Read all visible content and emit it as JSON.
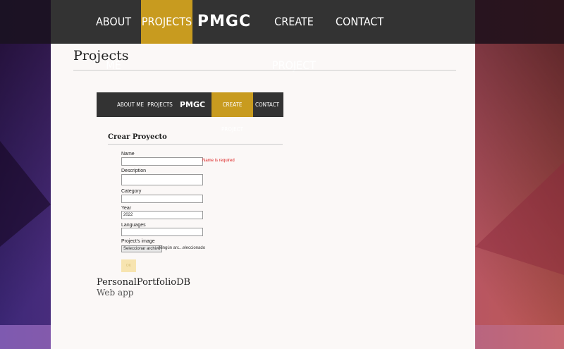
{
  "nav": {
    "items": [
      {
        "label": "ABOUT ME"
      },
      {
        "label": "PROJECTS",
        "active": true
      },
      {
        "label": "PMGC"
      },
      {
        "label": "CREATE PROJECT"
      },
      {
        "label": "CONTACT"
      }
    ]
  },
  "main": {
    "title": "Projects"
  },
  "preview": {
    "nav": {
      "items": [
        {
          "label": "ABOUT ME"
        },
        {
          "label": "PROJECTS"
        },
        {
          "label": "PMGC"
        },
        {
          "label": "CREATE PROJECT",
          "active": true
        },
        {
          "label": "CONTACT"
        }
      ]
    },
    "form": {
      "title": "Crear Proyecto",
      "fields": {
        "name": {
          "label": "Name",
          "value": "",
          "error": "Name is required"
        },
        "description": {
          "label": "Description",
          "value": ""
        },
        "category": {
          "label": "Category",
          "value": ""
        },
        "year": {
          "label": "Year",
          "value": "2022"
        },
        "languages": {
          "label": "Languages",
          "value": ""
        },
        "image": {
          "label": "Project's image",
          "button": "Seleccionar archivo",
          "status": "Ningún arc...eleccionado"
        }
      },
      "submit_label": "OK"
    }
  },
  "project": {
    "name": "PersonalPortfolioDB",
    "description": "Web app"
  },
  "colors": {
    "nav_bg": "#333333",
    "accent": "#c89b1f",
    "page_bg": "#fbf8f7",
    "error": "#dd2222"
  }
}
